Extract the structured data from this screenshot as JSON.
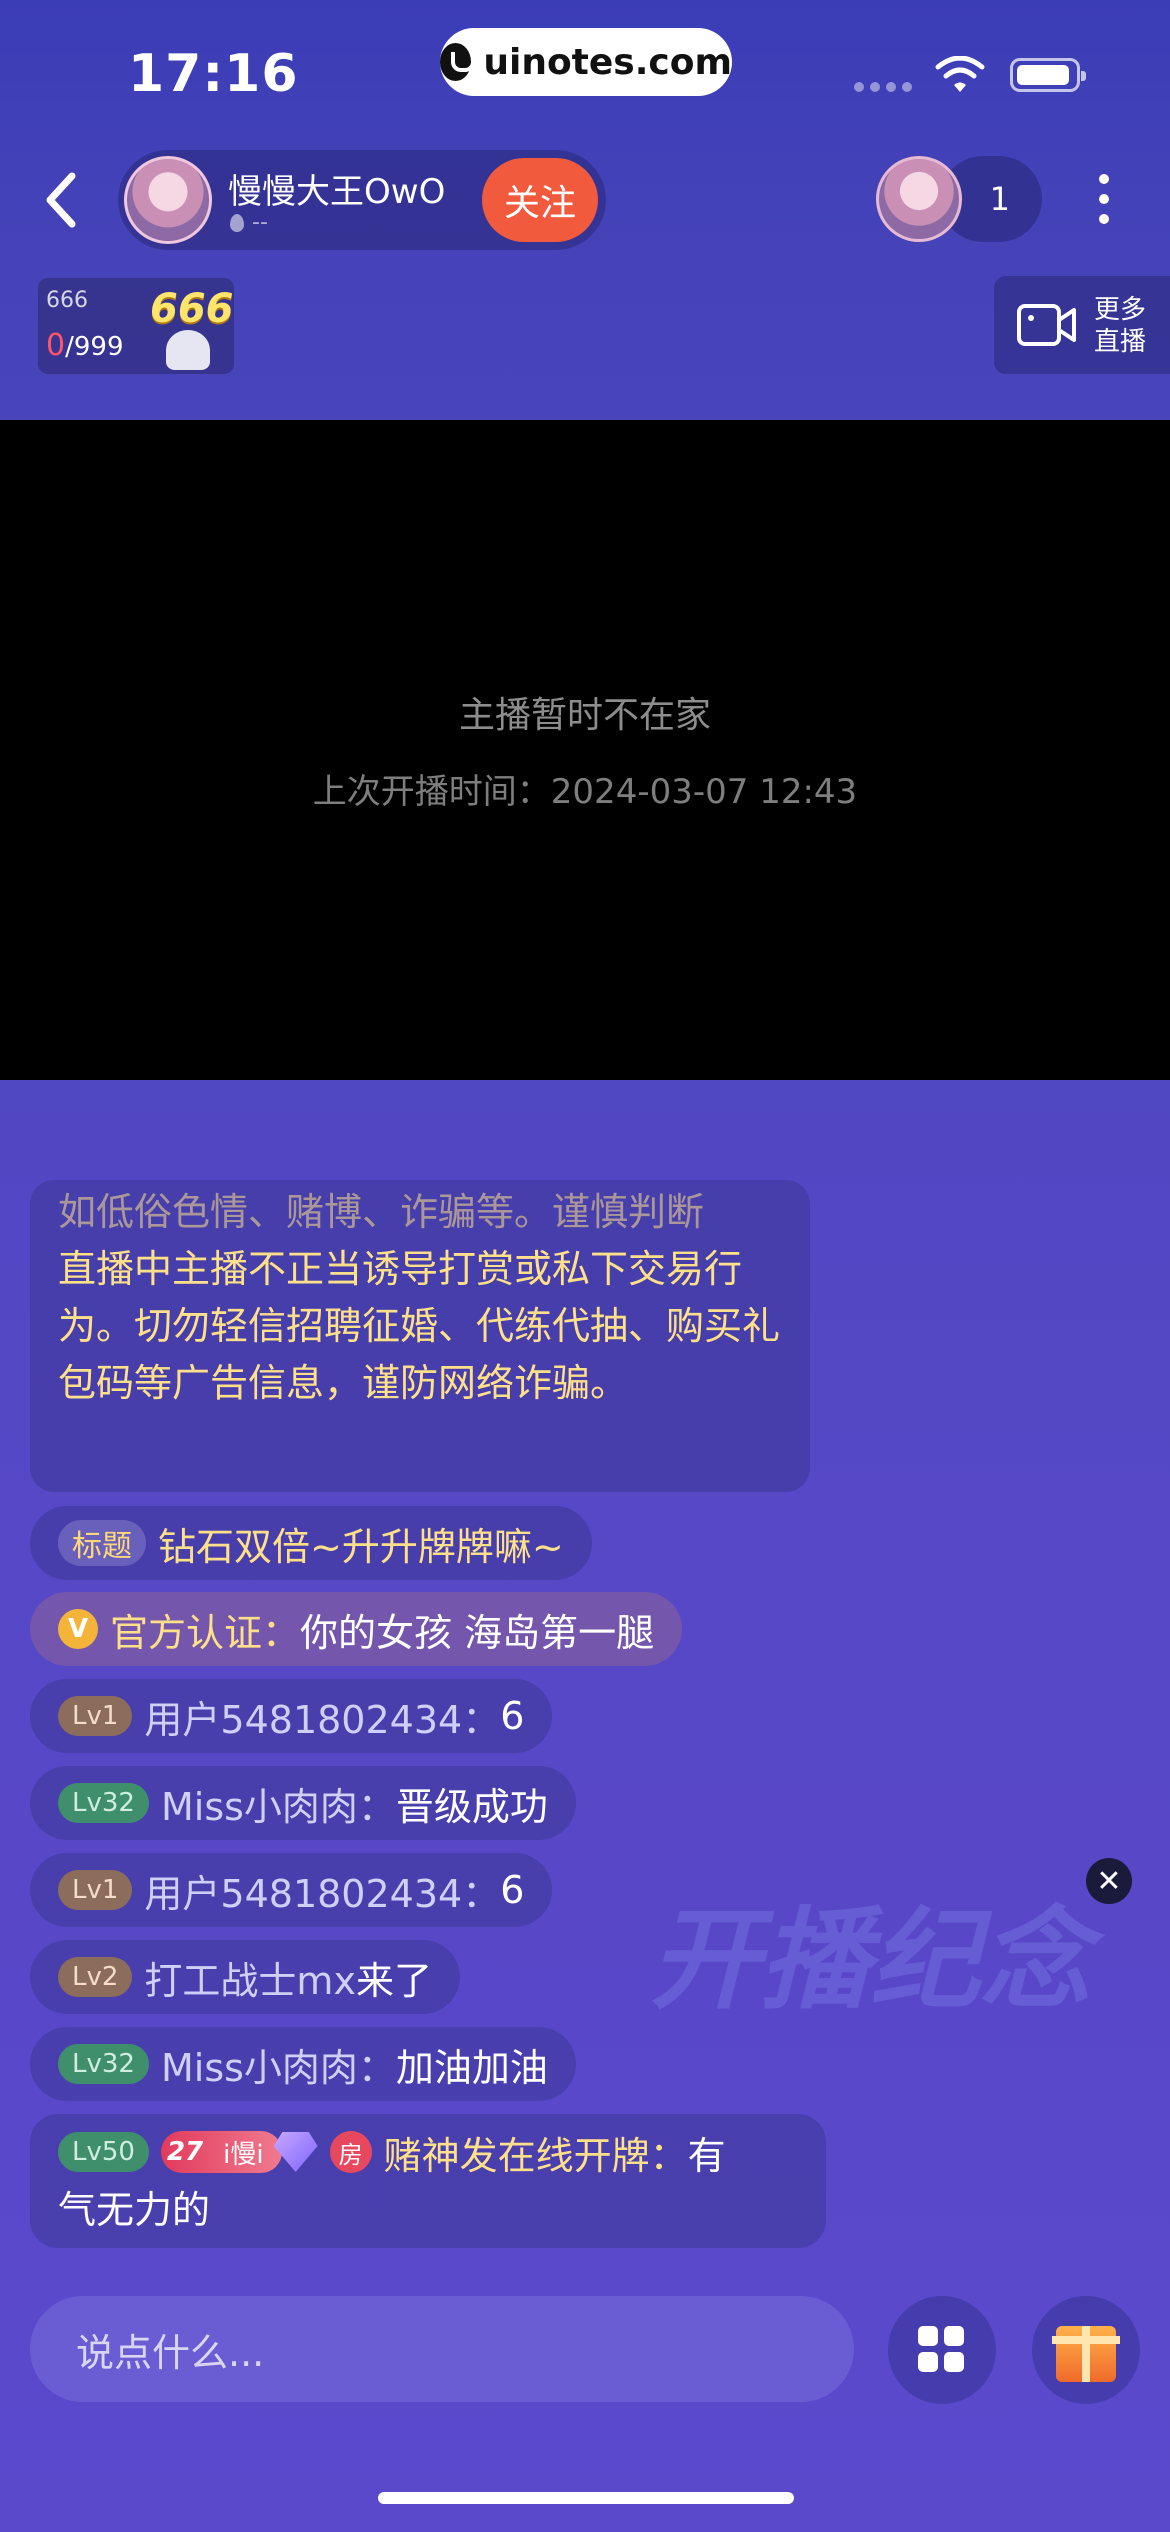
{
  "status_bar": {
    "time": "17:16",
    "url": "uinotes.com"
  },
  "header": {
    "host_name": "慢慢大王OwO",
    "host_sub": "--",
    "follow_label": "关注",
    "viewer_count": "1"
  },
  "score_card": {
    "top_value": "666",
    "current": "0",
    "total": "/999",
    "big_number": "666"
  },
  "more_live": {
    "label": "更多 直播"
  },
  "video": {
    "offline_message": "主播暂时不在家",
    "last_live": "上次开播时间：2024-03-07 12:43"
  },
  "chat": {
    "notice_dim_line": "如低俗色情、赌博、诈骗等。谨慎判断",
    "notice_lines": "直播中主播不正当诱导打赏或私下交易行为。切勿轻信招聘征婚、代练代抽、购买礼包码等广告信息，谨防网络诈骗。",
    "title_tag": "标题",
    "title_text": "钻石双倍~升升牌牌嘛~",
    "official_label": "官方认证：",
    "official_text": "你的女孩 海岛第一腿",
    "messages": [
      {
        "level": "Lv1",
        "user": "用户5481802434：",
        "text": "6"
      },
      {
        "level": "Lv32",
        "user": "Miss小肉肉：",
        "text": "晋级成功"
      },
      {
        "level": "Lv1",
        "user": "用户5481802434：",
        "text": "6"
      },
      {
        "level": "Lv2",
        "user": "打工战士mx",
        "text": " 来了"
      },
      {
        "level": "Lv32",
        "user": "Miss小肉肉：",
        "text": "加油加油"
      }
    ],
    "last_message": {
      "level": "Lv50",
      "fan_level": "27",
      "fan_name": "i慢i",
      "room_badge": "房",
      "user": "赌神发在线开牌：",
      "text_line1": "有",
      "text_line2": "气无力的"
    }
  },
  "watermark_text": "开播纪念",
  "bottom_bar": {
    "input_placeholder": "说点什么..."
  }
}
